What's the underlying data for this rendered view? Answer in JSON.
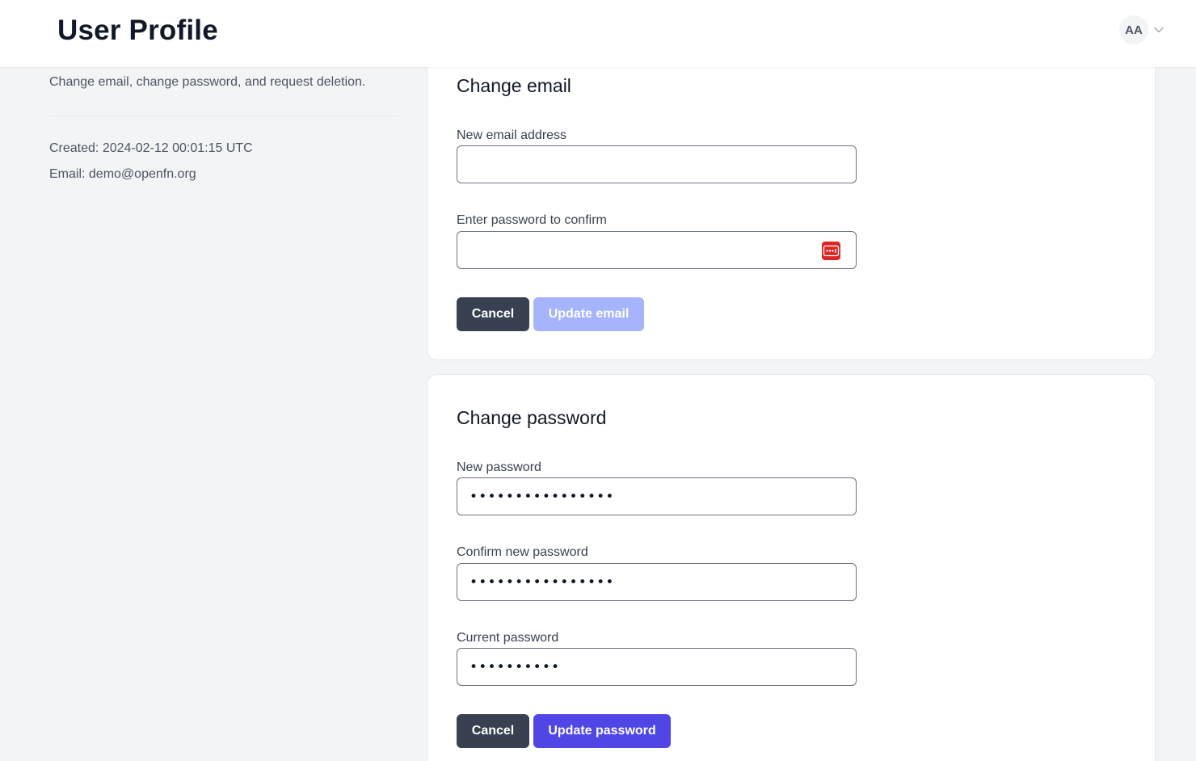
{
  "header": {
    "title": "User Profile",
    "avatar_initials": "AA",
    "chevron_icon": "chevron-down-icon"
  },
  "sidebar": {
    "description": "Change email, change password, and request deletion.",
    "created": "Created: 2024-02-12 00:01:15 UTC",
    "email": "Email: demo@openfn.org"
  },
  "change_email": {
    "title": "Change email",
    "new_email_label": "New email address",
    "new_email_value": "",
    "password_label": "Enter password to confirm",
    "password_value": "",
    "cancel_label": "Cancel",
    "submit_label": "Update email",
    "password_manager_icon": "password-manager-icon"
  },
  "change_password": {
    "title": "Change password",
    "new_password_label": "New password",
    "new_password_masked": "••••••••••••••••",
    "confirm_password_label": "Confirm new password",
    "confirm_password_masked": "••••••••••••••••",
    "current_password_label": "Current password",
    "current_password_masked": "••••••••••",
    "cancel_label": "Cancel",
    "submit_label": "Update password"
  },
  "colors": {
    "primary": "#4f46e5",
    "primary_disabled": "#a5b4fc",
    "cancel": "#374151",
    "password_manager": "#dc2626"
  }
}
